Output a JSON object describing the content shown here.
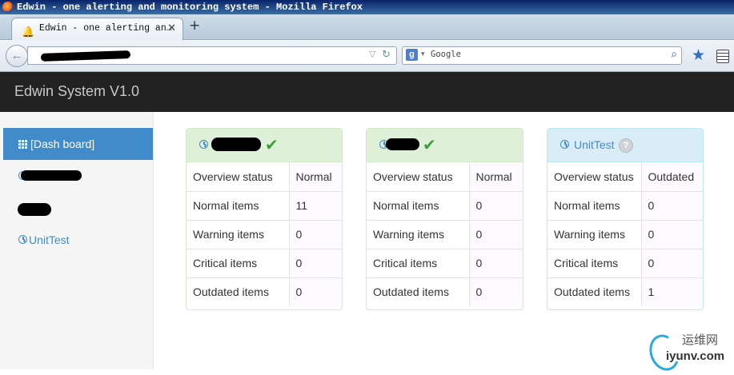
{
  "window": {
    "title": "Edwin - one alerting and monitoring system - Mozilla Firefox"
  },
  "browser": {
    "tab_title": "Edwin - one alerting an…",
    "tab_close": "✕",
    "new_tab": "+",
    "search_placeholder": "Google",
    "search_engine_letter": "g"
  },
  "app": {
    "brand": "Edwin System V1.0"
  },
  "sidebar": {
    "items": [
      {
        "label": "[Dash board]",
        "active": true
      },
      {
        "label": "",
        "redacted": true
      },
      {
        "label": "",
        "redacted": true
      },
      {
        "label": "UnitTest"
      }
    ]
  },
  "panels": [
    {
      "title": "",
      "status_icon": "check-icon",
      "rows": [
        {
          "label": "Overview status",
          "value": "Normal"
        },
        {
          "label": "Normal items",
          "value": "11"
        },
        {
          "label": "Warning items",
          "value": "0"
        },
        {
          "label": "Critical items",
          "value": "0"
        },
        {
          "label": "Outdated items",
          "value": "0"
        }
      ]
    },
    {
      "title": "",
      "status_icon": "check-icon",
      "rows": [
        {
          "label": "Overview status",
          "value": "Normal"
        },
        {
          "label": "Normal items",
          "value": "0"
        },
        {
          "label": "Warning items",
          "value": "0"
        },
        {
          "label": "Critical items",
          "value": "0"
        },
        {
          "label": "Outdated items",
          "value": "0"
        }
      ]
    },
    {
      "title": "UnitTest",
      "status_icon": "question-icon",
      "rows": [
        {
          "label": "Overview status",
          "value": "Outdated"
        },
        {
          "label": "Normal items",
          "value": "0"
        },
        {
          "label": "Warning items",
          "value": "0"
        },
        {
          "label": "Critical items",
          "value": "0"
        },
        {
          "label": "Outdated items",
          "value": "1"
        }
      ]
    }
  ],
  "watermark": {
    "cn": "运维网",
    "en": "iyunv.com"
  },
  "colors": {
    "ok_bg": "#dff0d8",
    "info_bg": "#d9edf7",
    "link": "#428bca",
    "header_bg": "#222222"
  }
}
